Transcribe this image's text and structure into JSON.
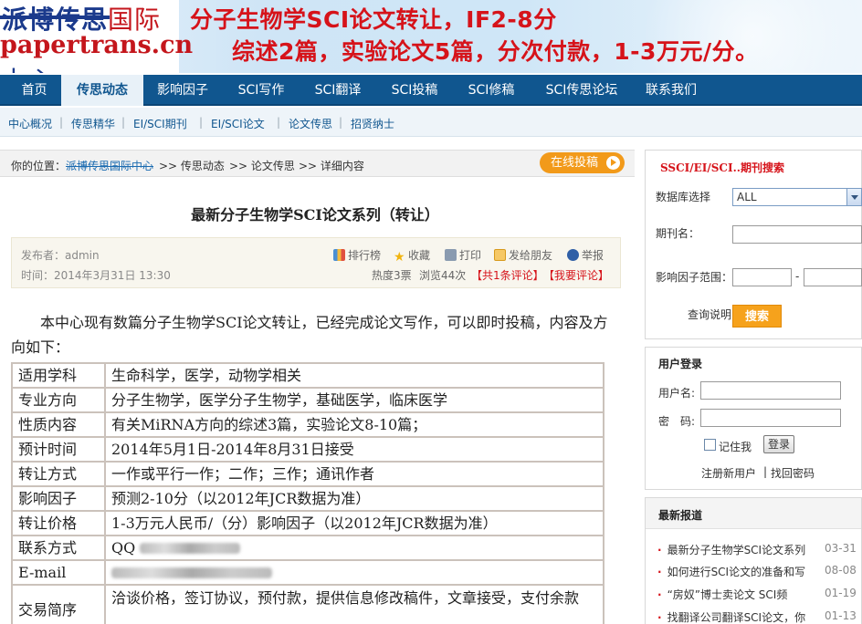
{
  "banner": {
    "logo_top": "派博传思",
    "logo_top_suffix": "国际",
    "logo_bottom": "papertrans.cn",
    "logo_bottom_suffix": "中心",
    "line1": "分子生物学SCI论文转让，IF2-8分",
    "line2": "综述2篇，实验论文5篇，分次付款，1-3万元/分。"
  },
  "main_nav": [
    "首页",
    "传思动态",
    "影响因子",
    "SCI写作",
    "SCI翻译",
    "SCI投稿",
    "SCI修稿",
    "SCI传思论坛",
    "联系我们"
  ],
  "sub_nav": [
    "中心概况",
    "传思精华",
    "EI/SCI期刊",
    "EI/SCI论文",
    "论文传思",
    "招贤纳士"
  ],
  "breadcrumb": {
    "prefix": "你的位置：",
    "home": "派博传思国际中心",
    "path1": ">> 传思动态",
    "path2": ">> 论文传思",
    "path3": ">> 详细内容"
  },
  "submit_button": "在线投稿",
  "article": {
    "title": "最新分子生物学SCI论文系列（转让）",
    "author": "发布者：admin",
    "time": "时间：2014年3月31日  13:30",
    "tools": [
      "排行榜",
      "收藏",
      "打印",
      "发给朋友",
      "举报"
    ],
    "heat": "热度3票",
    "views": "浏览44次",
    "comments": "【共1条评论】",
    "my_comment": "【我要评论】",
    "intro": "本中心现有数篇分子生物学SCI论文转让，已经完成论文写作，可以即时投稿，内容及方向如下：",
    "rows": [
      {
        "k": "适用学科",
        "v": "生命科学，医学，动物学相关"
      },
      {
        "k": "专业方向",
        "v": "分子生物学，医学分子生物学，基础医学，临床医学"
      },
      {
        "k": "性质内容",
        "v": "有关MiRNA方向的综述3篇，实验论文8-10篇；"
      },
      {
        "k": "预计时间",
        "v": "2014年5月1日-2014年8月31日接受"
      },
      {
        "k": "转让方式",
        "v": "一作或平行一作；二作；三作；通讯作者"
      },
      {
        "k": "影响因子",
        "v": "预测2-10分（以2012年JCR数据为准）"
      },
      {
        "k": "转让价格",
        "v": "1-3万元人民币/（分）影响因子（以2012年JCR数据为准）"
      },
      {
        "k": "联系方式",
        "v": "QQ"
      },
      {
        "k": "E-mail",
        "v": ""
      },
      {
        "k": "交易简序",
        "v": "洽谈价格，签订协议，预付款，提供信息修改稿件，文章接受，支付余款"
      }
    ]
  },
  "search_box": {
    "title": "SSCI/EI/SCI..期刊搜索",
    "db_label": "数据库选择",
    "db_value": "ALL",
    "journal_label": "期刊名：",
    "if_label": "影响因子范围：",
    "range_sep": "-",
    "help": "查询说明",
    "button": "搜索"
  },
  "login_box": {
    "title": "用户登录",
    "user_label": "用户名:",
    "pass_label": "密　码:",
    "remember": "记住我",
    "button": "登录",
    "register": "注册新用户",
    "sep": "|",
    "forgot": "找回密码"
  },
  "news_box": {
    "title": "最新报道",
    "items": [
      {
        "title": "最新分子生物学SCI论文系列",
        "date": "03-31"
      },
      {
        "title": "如何进行SCI论文的准备和写",
        "date": "08-08"
      },
      {
        "title": "“房奴”博士卖论文 SCI频",
        "date": "01-19"
      },
      {
        "title": "找翻译公司翻译SCI论文，你",
        "date": "01-13"
      }
    ]
  },
  "colors": {
    "nav_bg": "#10568f",
    "accent_red": "#d6131a",
    "accent_orange": "#f29a1a"
  }
}
